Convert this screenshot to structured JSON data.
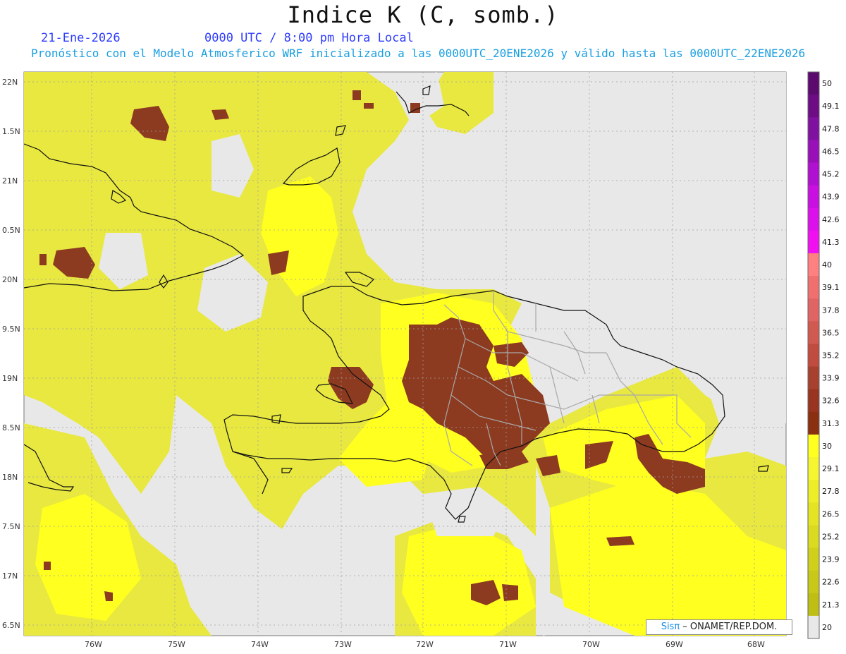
{
  "header": {
    "title": "Indice K (C, somb.)",
    "date": "21-Ene-2026",
    "time": "0000 UTC / 8:00 pm Hora Local",
    "subtitle": "Pronóstico con el Modelo Atmosferico WRF inicializado a las 0000UTC_20ENE2026 y válido hasta las  0000UTC_22ENE2026"
  },
  "axes": {
    "lat_labels": [
      "22N",
      "1.5N",
      "21N",
      "0.5N",
      "20N",
      "9.5N",
      "19N",
      "8.5N",
      "18N",
      "7.5N",
      "17N",
      "6.5N"
    ],
    "lon_labels": [
      "76W",
      "75W",
      "74W",
      "73W",
      "72W",
      "71W",
      "70W",
      "69W",
      "68W"
    ]
  },
  "colorbar": {
    "labels": [
      "50",
      "49.1",
      "47.8",
      "46.5",
      "45.2",
      "43.9",
      "42.6",
      "41.3",
      "40",
      "39.1",
      "37.8",
      "36.5",
      "35.2",
      "33.9",
      "32.6",
      "31.3",
      "30",
      "29.1",
      "27.8",
      "26.5",
      "25.2",
      "23.9",
      "22.6",
      "21.3",
      "20"
    ],
    "colors": [
      "#5c0a6e",
      "#6e0c85",
      "#8010a0",
      "#9a10b8",
      "#b010d0",
      "#c810e0",
      "#dc10ea",
      "#f010f0",
      "#ff8080",
      "#f07070",
      "#e06464",
      "#d05a50",
      "#c04c40",
      "#a84030",
      "#983420",
      "#8a3010",
      "#ffff20",
      "#f6f630",
      "#eeee28",
      "#e4e424",
      "#dada20",
      "#d0d01c",
      "#c8c818",
      "#bebe14",
      "#e8e8e8"
    ]
  },
  "credit": {
    "sis": "Sisπ",
    "text": " – ONAMET/REP.DOM."
  }
}
